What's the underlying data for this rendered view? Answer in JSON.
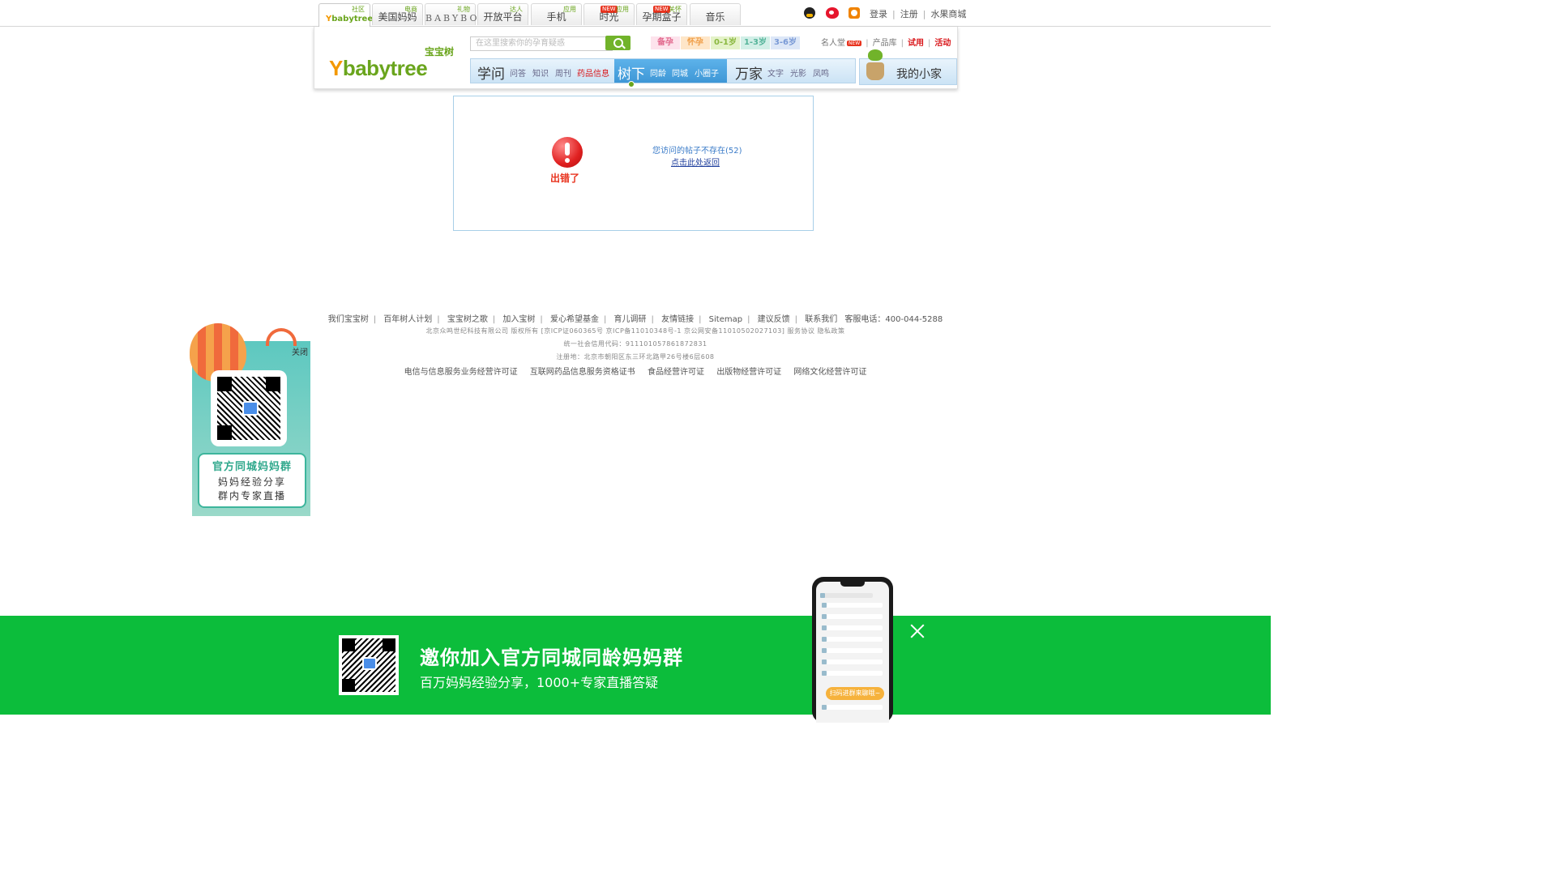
{
  "topbar": {
    "tabs": [
      {
        "label": "",
        "tag": "社区",
        "logo": "babytree"
      },
      {
        "label": "美国妈妈",
        "tag": "电商"
      },
      {
        "label": "BABYBOX",
        "tag": "礼物"
      },
      {
        "label": "开放平台",
        "tag": "达人"
      },
      {
        "label": "手机",
        "tag": "应用"
      },
      {
        "label": "时光",
        "tag": "应用",
        "new": "NEW"
      },
      {
        "label": "孕期盒子",
        "tag": "关怀",
        "new": "NEW"
      },
      {
        "label": "音乐",
        "tag": ""
      }
    ],
    "login": "登录",
    "register": "注册",
    "mall": "水果商城"
  },
  "header": {
    "brand_cn": "宝宝树",
    "brand_en_a": "Y",
    "brand_en_b": "babytree",
    "search_placeholder": "在这里搜索你的孕育疑惑",
    "stages": [
      "备孕",
      "怀孕",
      "0-1岁",
      "1-3岁",
      "3-6岁"
    ],
    "links": {
      "celebrity": "名人堂",
      "celebrity_badge": "NEW",
      "products": "产品库",
      "trial": "试用",
      "events": "活动"
    },
    "nav": {
      "seg1_big": "学问",
      "seg1_items": [
        "问答",
        "知识",
        "周刊",
        "药品信息"
      ],
      "seg2_big": "树下",
      "seg2_items": [
        "同龄",
        "同城",
        "小圈子"
      ],
      "seg3_big": "万家",
      "seg3_items": [
        "文字",
        "光影",
        "凤鸣"
      ]
    },
    "my_home": "我的小家"
  },
  "error": {
    "tag": "出错了",
    "message": "您访问的帖子不存在(52)",
    "back_link": "点击此处返回"
  },
  "footer": {
    "links": [
      "我们宝宝树",
      "百年树人计划",
      "宝宝树之歌",
      "加入宝树",
      "爱心希望基金",
      "育儿调研",
      "友情链接",
      "Sitemap",
      "建议反馈",
      "联系我们"
    ],
    "hotline": "客服电话：400-044-5288",
    "copyright": "北京众鸣世纪科技有限公司 版权所有 [京ICP证060365号 京ICP备11010348号-1 京公网安备11010502027103] 服务协议 隐私政策",
    "credit_code": "统一社会信用代码：911101057861872831",
    "address": "注册地：北京市朝阳区东三环北路甲26号楼6层608",
    "licenses": [
      "电信与信息服务业务经营许可证",
      "互联网药品信息服务资格证书",
      "食品经营许可证",
      "出版物经营许可证",
      "网络文化经营许可证"
    ]
  },
  "float_promo": {
    "close": "关闭",
    "line1": "官方同城妈妈群",
    "line2": "妈妈经验分享",
    "line3": "群内专家直播"
  },
  "banner": {
    "title": "邀你加入官方同城同龄妈妈群",
    "subtitle": "百万妈妈经验分享，1000+专家直播答疑",
    "phone_button": "扫码进群来聊哦~"
  },
  "colors": {
    "brand_green": "#6aa51d",
    "banner_green": "#0cbd3b",
    "nav_blue": "#3e97d6",
    "link_red": "#d9161a"
  }
}
